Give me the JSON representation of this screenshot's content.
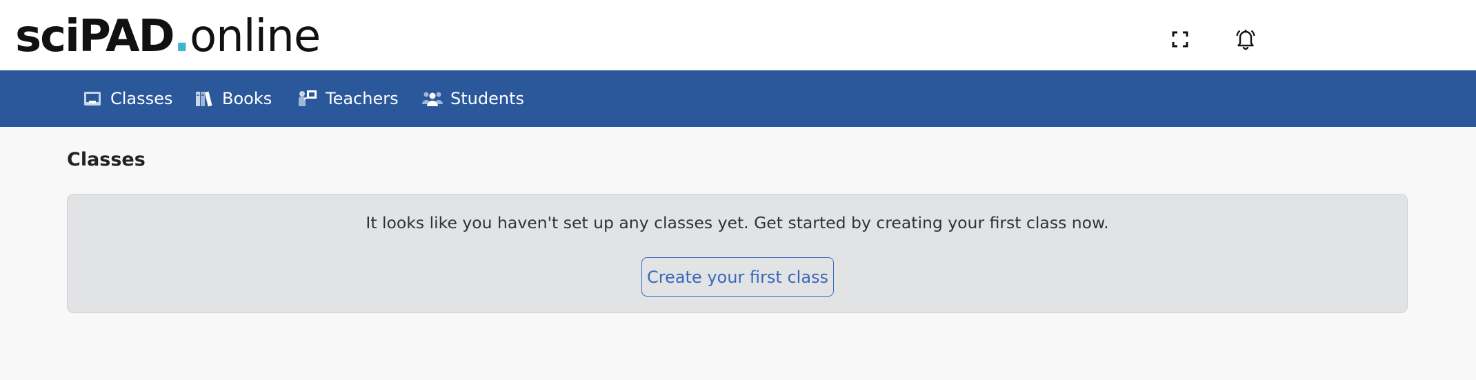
{
  "app": {
    "logo_bold": "sciPAD",
    "logo_dot": ".",
    "logo_light": "online",
    "brand_color": "#2b589b",
    "logo_dot_color": "#3fb4cf"
  },
  "header_icons": {
    "fullscreen": "fullscreen-icon",
    "notifications": "bell-icon"
  },
  "nav": {
    "items": [
      {
        "label": "Classes",
        "icon": "classroom-icon"
      },
      {
        "label": "Books",
        "icon": "books-icon"
      },
      {
        "label": "Teachers",
        "icon": "teacher-icon"
      },
      {
        "label": "Students",
        "icon": "students-icon"
      }
    ]
  },
  "main": {
    "title": "Classes",
    "empty_state": {
      "message": "It looks like you haven't set up any classes yet. Get started by creating your first class now.",
      "button_label": "Create your first class"
    }
  }
}
